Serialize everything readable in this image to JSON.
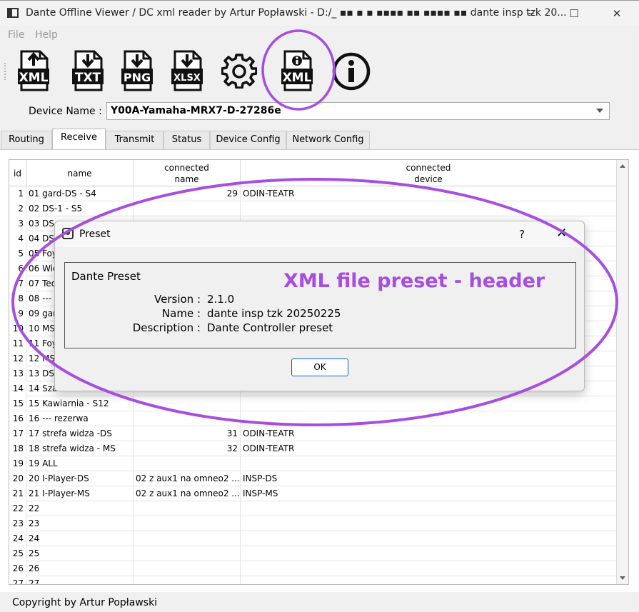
{
  "window": {
    "title": "Dante Offline Viewer / DC xml reader by Artur Popławski - D:/_ ▪▪ ▪  ▪ ▪▪▪▪  ▪▪ ▪▪▪▪ ▪▪ dante insp tzk 20...",
    "minimize_glyph": "─",
    "maximize_glyph": "☐",
    "close_glyph": "✕"
  },
  "menu": {
    "file": "File",
    "help": "Help"
  },
  "toolbar": {
    "buttons": [
      {
        "label": "XML",
        "icon": "xml-upload-icon"
      },
      {
        "label": "TXT",
        "icon": "txt-download-icon"
      },
      {
        "label": "PNG",
        "icon": "png-download-icon"
      },
      {
        "label": "XLSX",
        "icon": "xlsx-download-icon"
      },
      {
        "label": "",
        "icon": "gear-icon"
      },
      {
        "label": "XML",
        "icon": "xml-info-icon"
      },
      {
        "label": "",
        "icon": "info-icon"
      }
    ]
  },
  "device": {
    "label": "Device Name :",
    "value": "Y00A-Yamaha-MRX7-D-27286e"
  },
  "tabs": [
    "Routing",
    "Receive",
    "Transmit",
    "Status",
    "Device Config",
    "Network Config"
  ],
  "active_tab": "Receive",
  "table": {
    "headers": {
      "id": "id",
      "name": "name",
      "connected_name": "connected\nname",
      "connected_device": "connected\ndevice"
    },
    "rows": [
      [
        "1",
        "01 gard-DS - S4",
        "29",
        "ODIN-TEATR"
      ],
      [
        "2",
        "02 DS-1 - S5",
        "",
        ""
      ],
      [
        "3",
        "03 DS",
        "",
        ""
      ],
      [
        "4",
        "04 DS",
        "",
        ""
      ],
      [
        "5",
        "05 Foy",
        "",
        ""
      ],
      [
        "6",
        "06 Wie",
        "",
        ""
      ],
      [
        "7",
        "07 Teo",
        "",
        ""
      ],
      [
        "8",
        "08 ---",
        "",
        ""
      ],
      [
        "9",
        "09 gar",
        "",
        ""
      ],
      [
        "10",
        "10 MS",
        "",
        ""
      ],
      [
        "11",
        "11 Foy",
        "",
        ""
      ],
      [
        "12",
        "12 MS",
        "",
        ""
      ],
      [
        "13",
        "13 DSI",
        "",
        ""
      ],
      [
        "14",
        "14 Szatnia - S11",
        "",
        ""
      ],
      [
        "15",
        "15 Kawiarnia - S12",
        "",
        ""
      ],
      [
        "16",
        "16 --- rezerwa",
        "",
        ""
      ],
      [
        "17",
        "17 strefa widza -DS",
        "31",
        "ODIN-TEATR"
      ],
      [
        "18",
        "18 strefa widza - MS",
        "32",
        "ODIN-TEATR"
      ],
      [
        "19",
        "19 ALL",
        "",
        ""
      ],
      [
        "20",
        "20 I-Player-DS",
        "02 z aux1 na omneo2 ...",
        "INSP-DS"
      ],
      [
        "21",
        "21 I-Player-MS",
        "02 z aux1 na omneo2 ...",
        "INSP-MS"
      ],
      [
        "22",
        "22",
        "",
        ""
      ],
      [
        "23",
        "23",
        "",
        ""
      ],
      [
        "24",
        "24",
        "",
        ""
      ],
      [
        "25",
        "25",
        "",
        ""
      ],
      [
        "26",
        "26",
        "",
        ""
      ],
      [
        "27",
        "27",
        "",
        ""
      ]
    ]
  },
  "status_bar": "Copyright by Artur Popławski",
  "dialog": {
    "title": "Preset",
    "help": "?",
    "close": "✕",
    "group_title": "Dante Preset",
    "fields": [
      {
        "key": "Version :",
        "value": "2.1.0"
      },
      {
        "key": "Name :",
        "value": "dante insp tzk 20250225"
      },
      {
        "key": "Description :",
        "value": "Dante Controller preset"
      }
    ],
    "ok": "OK"
  },
  "annotation": {
    "label": "XML file preset - header",
    "color": "#a64ee0"
  }
}
